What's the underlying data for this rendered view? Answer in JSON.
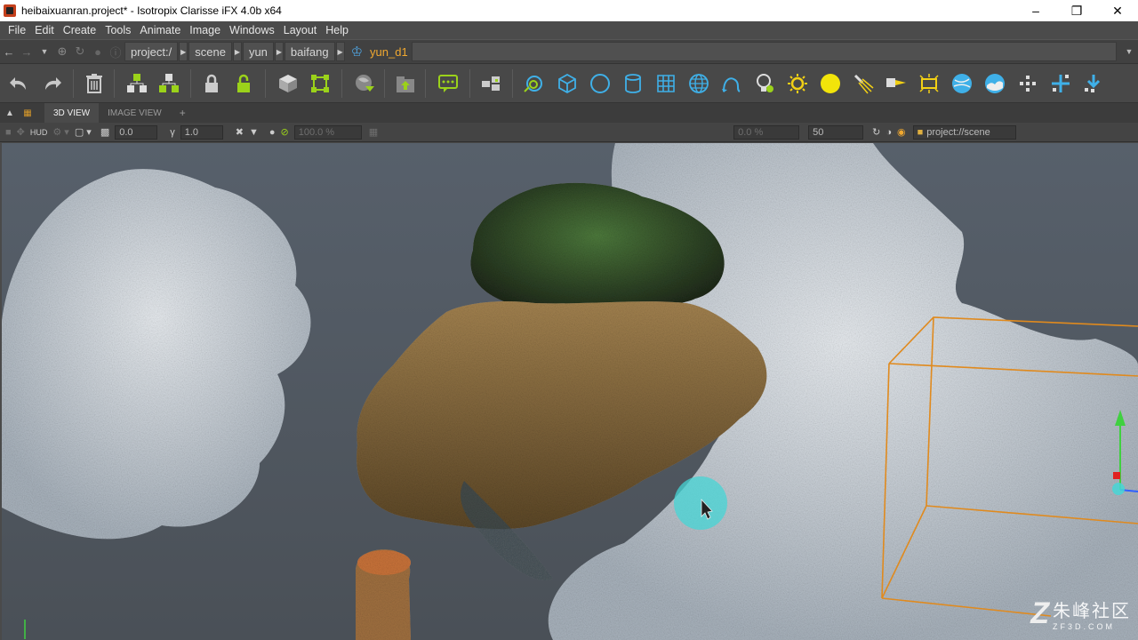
{
  "window": {
    "title": "heibaixuanran.project* - Isotropix Clarisse iFX 4.0b x64",
    "controls": [
      "minimize",
      "restore",
      "close"
    ]
  },
  "menu": [
    "File",
    "Edit",
    "Create",
    "Tools",
    "Animate",
    "Image",
    "Windows",
    "Layout",
    "Help"
  ],
  "pathbar": {
    "segments": [
      "project:/",
      "scene",
      "yun",
      "baifang"
    ],
    "current": "yun_d1"
  },
  "toolbar": {
    "icons": [
      "undo-icon",
      "redo-icon",
      "delete-icon",
      "group-icon",
      "ungroup-icon",
      "lock-icon",
      "unlock-icon",
      "instance-icon",
      "snap-icon",
      "isolate-icon",
      "context-up-icon",
      "comment-icon",
      "layer-icon",
      "cycle-icon",
      "box-icon",
      "circle-icon",
      "cylinder-icon",
      "grid-icon",
      "sphere-icon",
      "curve-icon",
      "light-bulb-icon",
      "sun-icon",
      "yellow-sphere-icon",
      "spot-light-icon",
      "directional-light-icon",
      "area-light-icon",
      "globe-icon",
      "sky-icon",
      "scatter-icon",
      "add-point-icon",
      "import-icon"
    ],
    "accent": "#3fb0e8"
  },
  "tabs": {
    "items": [
      "3D VIEW",
      "IMAGE VIEW"
    ],
    "active": "3D VIEW",
    "add_label": "+"
  },
  "viewport_options": {
    "hud_label": "HUD",
    "exposure": "0.0",
    "gamma": "1.0",
    "progress": "100.0 %",
    "sampling": "0.0 %",
    "samples": "50",
    "context": "project://scene"
  },
  "viewport": {
    "bbox_color": "#e08a1e",
    "cursor_highlight": "#46d6d6"
  },
  "watermark": {
    "main": "朱峰社区",
    "sub": "ZF3D.COM"
  }
}
